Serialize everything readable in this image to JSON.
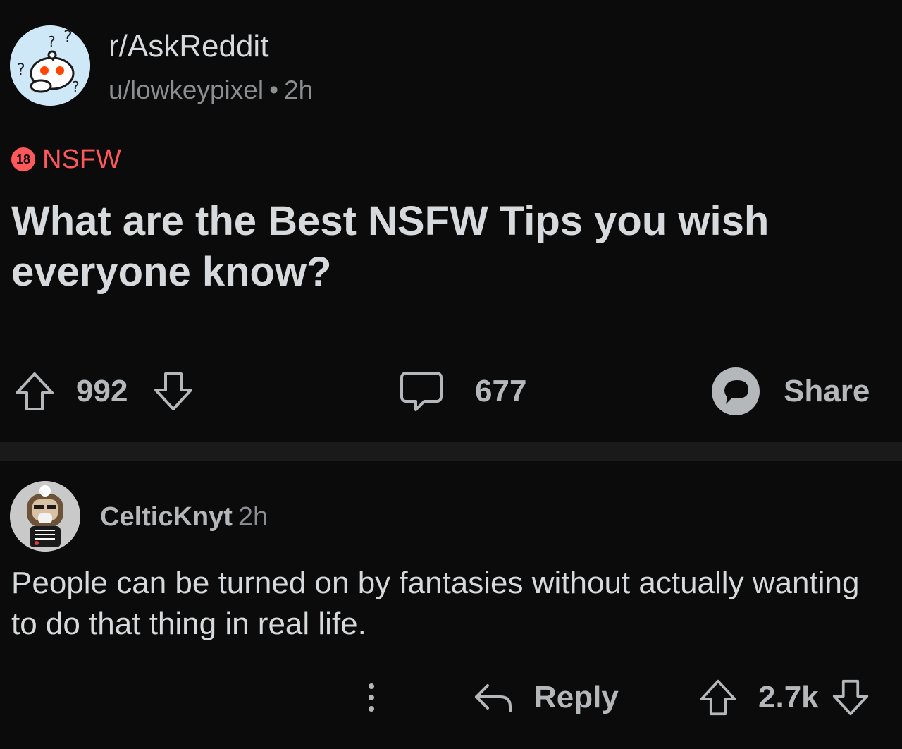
{
  "post": {
    "subreddit": "r/AskReddit",
    "author": "u/lowkeypixel",
    "separator": "•",
    "age": "2h",
    "nsfw_badge": "18",
    "nsfw_label": "NSFW",
    "title": "What are the Best NSFW Tips you wish everyone know?",
    "upvotes": "992",
    "comments_count": "677",
    "share_label": "Share"
  },
  "comment": {
    "author": "CelticKnyt",
    "age": "2h",
    "body": "People can be turned on by fantasies without actually wanting to do that thing in real life.",
    "reply_label": "Reply",
    "score": "2.7k"
  },
  "colors": {
    "background": "#0b0b0b",
    "divider": "#1a1a1b",
    "nsfw_red": "#ff585b",
    "text_primary": "#d7dadc",
    "text_muted": "#8b8f92"
  }
}
